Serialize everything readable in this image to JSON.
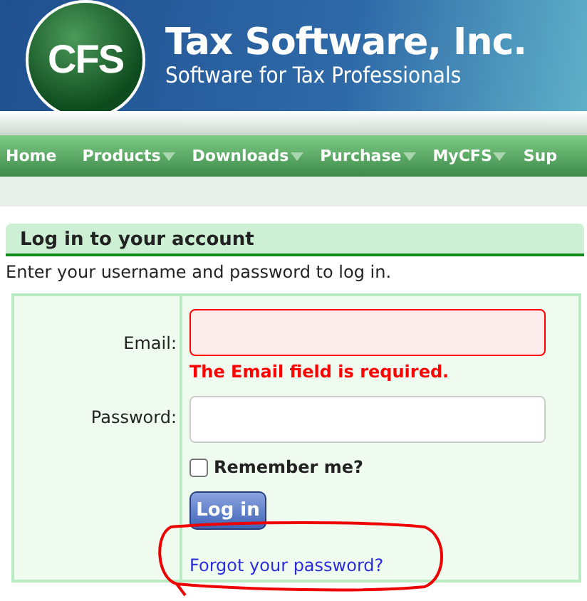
{
  "header": {
    "logo": "CFS",
    "title": "Tax Software, Inc.",
    "tagline": "Software for Tax Professionals"
  },
  "nav": [
    {
      "label": "Home",
      "has_menu": false
    },
    {
      "label": "Products",
      "has_menu": true
    },
    {
      "label": "Downloads",
      "has_menu": true
    },
    {
      "label": "Purchase",
      "has_menu": true
    },
    {
      "label": "MyCFS",
      "has_menu": true
    },
    {
      "label": "Sup",
      "has_menu": false
    }
  ],
  "login": {
    "title": "Log in to your account",
    "intro": "Enter your username and password to log in.",
    "fields": [
      {
        "label": "Email:",
        "invalid": true,
        "error": "The Email field is required."
      },
      {
        "label": "Password:",
        "invalid": false
      }
    ],
    "remember": {
      "label": "Remember me?",
      "checked": false
    },
    "button": "Log in",
    "forgot_link": "Forgot your password?",
    "annotation": true
  }
}
